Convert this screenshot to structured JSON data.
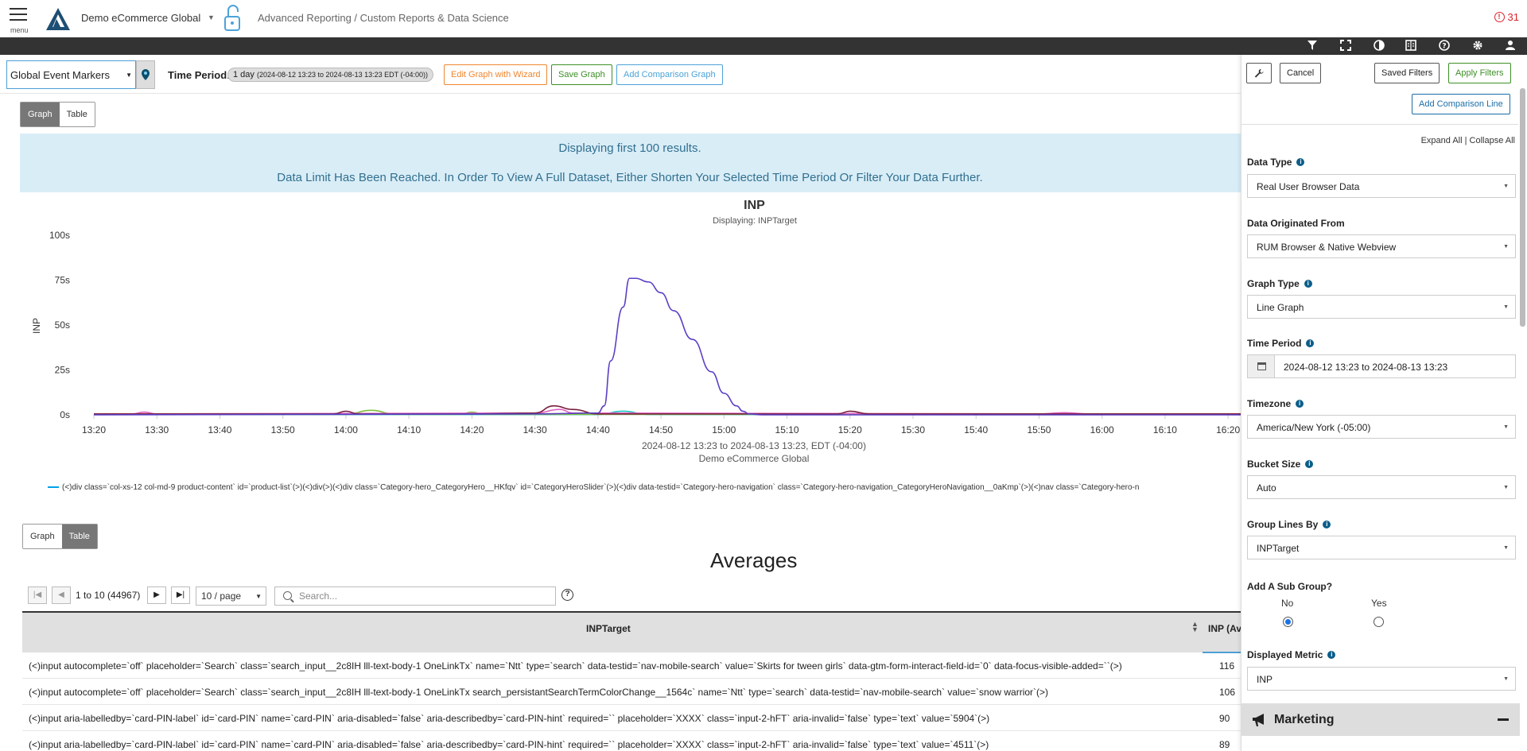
{
  "header": {
    "menu_label": "menu",
    "org_name": "Demo eCommerce Global",
    "breadcrumb": "Advanced Reporting / Custom Reports & Data Science",
    "alert_count": "31"
  },
  "toolbar": {
    "event_markers": "Global Event Markers",
    "time_period_label": "Time Period:",
    "time_period_value": "1 day",
    "time_period_range": "(2024-08-12 13:23 to 2024-08-13 13:23 EDT (-04:00))",
    "edit_wizard": "Edit Graph with Wizard",
    "save_graph": "Save Graph",
    "add_comparison_graph": "Add Comparison Graph",
    "colors": {
      "orange": "#f0862e",
      "green": "#3d8f27",
      "blue": "#4da3d8"
    }
  },
  "view_toggle_top": {
    "graph": "Graph",
    "table": "Table"
  },
  "view_toggle_bottom": {
    "graph": "Graph",
    "table": "Table"
  },
  "notice": {
    "line1": "Displaying first 100 results.",
    "line2": "Data Limit Has Been Reached. In Order To View A Full Dataset, Either Shorten Your Selected Time Period Or Filter Your Data Further."
  },
  "chart_data": {
    "type": "line",
    "title": "INP",
    "subtitle": "Displaying: INPTarget",
    "ylabel": "INP",
    "xlabel": "2024-08-12 13:23 to 2024-08-13 13:23, EDT (-04:00)",
    "xlabel2": "Demo eCommerce Global",
    "y_ticks": [
      "100s",
      "75s",
      "50s",
      "25s",
      "0s"
    ],
    "ylim": [
      0,
      100
    ],
    "x_ticks": [
      "13:20",
      "13:30",
      "13:40",
      "13:50",
      "14:00",
      "14:10",
      "14:20",
      "14:30",
      "14:40",
      "14:50",
      "15:00",
      "15:10",
      "15:20",
      "15:30",
      "15:40",
      "15:50",
      "16:00",
      "16:10",
      "16:20"
    ],
    "x_range_minutes": [
      800,
      982
    ],
    "series": [
      {
        "color": "#5b3fc4",
        "x": [
          800,
          870,
          880,
          881,
          882,
          884,
          885,
          886,
          888,
          890,
          892,
          895,
          898,
          900,
          902,
          903,
          904,
          906,
          982
        ],
        "y": [
          0,
          0.5,
          1,
          5,
          30,
          60,
          76,
          76,
          74,
          68,
          58,
          42,
          24,
          12,
          5,
          2,
          0.5,
          0,
          0
        ]
      },
      {
        "color": "#7a1f3d",
        "x": [
          800,
          838,
          840,
          842,
          860,
          870,
          873,
          876,
          880,
          918,
          920,
          923,
          982
        ],
        "y": [
          0.5,
          0.5,
          2,
          0.5,
          0.5,
          1,
          5,
          3,
          0.5,
          0.5,
          2,
          0.5,
          0.5
        ]
      },
      {
        "color": "#e060c0",
        "x": [
          800,
          806,
          808,
          810,
          870,
          874,
          876,
          950,
          954,
          958,
          982
        ],
        "y": [
          0.5,
          0.5,
          1.5,
          0.5,
          1,
          3,
          1,
          0.5,
          1.2,
          0.5,
          0.5
        ]
      },
      {
        "color": "#7fbf3f",
        "x": [
          800,
          840,
          844,
          848,
          858,
          860,
          862,
          982
        ],
        "y": [
          0.3,
          0.3,
          2.5,
          0.3,
          0.3,
          1.5,
          0.3,
          0.3
        ]
      },
      {
        "color": "#20c0c0",
        "x": [
          800,
          880,
          884,
          888,
          982
        ],
        "y": [
          0.2,
          0.2,
          2,
          0.2,
          0.2
        ]
      },
      {
        "color": "#e08030",
        "x": [
          800,
          982
        ],
        "y": [
          0.6,
          0.6
        ]
      }
    ],
    "legend_text": "(<)div class=`col-xs-12 col-md-9 product-content` id=`product-list`(>)(<)div(>)(<)div class=`Category-hero_CategoryHero__HKfqv` id=`CategoryHeroSlider`(>)(<)div data-testid=`Category-hero-navigation` class=`Category-hero-navigation_CategoryHeroNavigation__0aKmp`(>)(<)nav class=`Category-hero-n"
  },
  "table": {
    "heading": "Averages",
    "pager_range": "1 to 10 (44967)",
    "page_size": "10 / page",
    "search_placeholder": "Search...",
    "col_main": "INPTarget",
    "col_inp": "INP (Av",
    "rows": [
      {
        "target": "(<)input autocomplete=`off` placeholder=`Search` class=`search_input__2c8IH lll-text-body-1 OneLinkTx` name=`Ntt` type=`search` data-testid=`nav-mobile-search` value=`Skirts for tween girls` data-gtm-form-interact-field-id=`0` data-focus-visible-added=``(>)",
        "inp": "116"
      },
      {
        "target": "(<)input autocomplete=`off` placeholder=`Search` class=`search_input__2c8IH lll-text-body-1 OneLinkTx search_persistantSearchTermColorChange__1564c` name=`Ntt` type=`search` data-testid=`nav-mobile-search` value=`snow warrior`(>)",
        "inp": "106"
      },
      {
        "target": "(<)input aria-labelledby=`card-PIN-label` id=`card-PIN` name=`card-PIN` aria-disabled=`false` aria-describedby=`card-PIN-hint` required=`` placeholder=`XXXX` class=`input-2-hFT` aria-invalid=`false` type=`text` value=`5904`(>)",
        "inp": "90"
      },
      {
        "target": "(<)input aria-labelledby=`card-PIN-label` id=`card-PIN` name=`card-PIN` aria-disabled=`false` aria-describedby=`card-PIN-hint` required=`` placeholder=`XXXX` class=`input-2-hFT` aria-invalid=`false` type=`text` value=`4511`(>)",
        "inp": "89"
      }
    ]
  },
  "panel": {
    "cancel": "Cancel",
    "saved_filters": "Saved Filters",
    "apply_filters": "Apply Filters",
    "add_comparison_line": "Add Comparison Line",
    "expand_collapse": "Expand All | Collapse All",
    "data_type_label": "Data Type",
    "data_type_value": "Real User Browser Data",
    "origin_label": "Data Originated From",
    "origin_value": "RUM Browser & Native Webview",
    "graph_type_label": "Graph Type",
    "graph_type_value": "Line Graph",
    "time_period_label": "Time Period",
    "time_period_value": "2024-08-12 13:23 to 2024-08-13 13:23",
    "timezone_label": "Timezone",
    "timezone_value": "America/New York (-05:00)",
    "bucket_label": "Bucket Size",
    "bucket_value": "Auto",
    "group_label": "Group Lines By",
    "group_value": "INPTarget",
    "subgroup_label": "Add A Sub Group?",
    "subgroup_no": "No",
    "subgroup_yes": "Yes",
    "subgroup_selected": "No",
    "metric_label": "Displayed Metric",
    "metric_value": "INP",
    "section_marketing": "Marketing"
  }
}
